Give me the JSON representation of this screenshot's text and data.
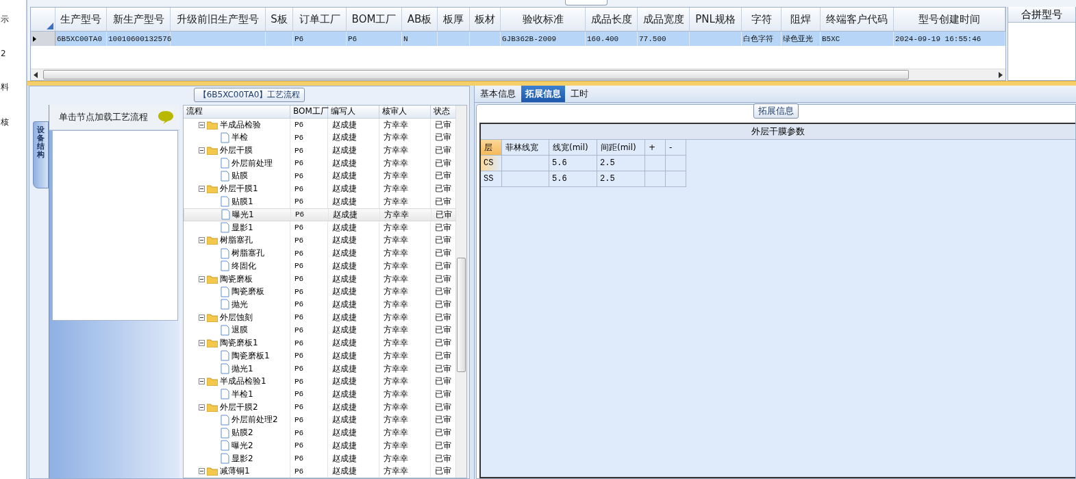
{
  "left_strip": [
    "示",
    "2",
    "料",
    "核"
  ],
  "main_grid": {
    "columns": [
      "生产型号",
      "新生产型号",
      "升级前旧生产型号",
      "S板",
      "订单工厂",
      "BOM工厂",
      "AB板",
      "板厚",
      "板材",
      "验收标准",
      "成品长度",
      "成品宽度",
      "PNL规格",
      "字符",
      "阻焊",
      "终端客户代码",
      "型号创建时间"
    ],
    "rows": [
      {
        "selected": true,
        "cells": [
          "6B5XC00TA0",
          "10010600132576",
          null,
          null,
          "P6",
          "P6",
          "N",
          null,
          null,
          "GJB362B-2009",
          "160.400",
          "77.500",
          null,
          "白色字符",
          "绿色亚光",
          "B5XC",
          "2024-09-19 16:55:46"
        ]
      }
    ]
  },
  "merge_panel": {
    "title": "合拼型号"
  },
  "process_panel": {
    "title": "【6B5XC00TA0】工艺流程",
    "side_tab": "设备结构",
    "hint": "单击节点加载工艺流程",
    "columns": [
      "流程",
      "BOM工厂",
      "编写人",
      "核审人",
      "状态"
    ],
    "tree": [
      {
        "name": "半成品检验",
        "bom": "P6",
        "author": "赵成捷",
        "reviewer": "方幸幸",
        "status": "已审",
        "expanded": true,
        "children": [
          {
            "name": "半检",
            "bom": "P6",
            "author": "赵成捷",
            "reviewer": "方幸幸",
            "status": "已审",
            "selected": false
          }
        ]
      },
      {
        "name": "外层干膜",
        "bom": "P6",
        "author": "赵成捷",
        "reviewer": "方幸幸",
        "status": "已审",
        "expanded": true,
        "children": [
          {
            "name": "外层前处理",
            "bom": "P6",
            "author": "赵成捷",
            "reviewer": "方幸幸",
            "status": "已审",
            "selected": false
          },
          {
            "name": "贴膜",
            "bom": "P6",
            "author": "赵成捷",
            "reviewer": "方幸幸",
            "status": "已审",
            "selected": false
          }
        ]
      },
      {
        "name": "外层干膜1",
        "bom": "P6",
        "author": "赵成捷",
        "reviewer": "方幸幸",
        "status": "已审",
        "expanded": true,
        "children": [
          {
            "name": "贴膜1",
            "bom": "P6",
            "author": "赵成捷",
            "reviewer": "方幸幸",
            "status": "已审",
            "selected": false
          },
          {
            "name": "曝光1",
            "bom": "P6",
            "author": "赵成捷",
            "reviewer": "方幸幸",
            "status": "已审",
            "selected": true
          },
          {
            "name": "显影1",
            "bom": "P6",
            "author": "赵成捷",
            "reviewer": "方幸幸",
            "status": "已审",
            "selected": false
          }
        ]
      },
      {
        "name": "树脂塞孔",
        "bom": "P6",
        "author": "赵成捷",
        "reviewer": "方幸幸",
        "status": "已审",
        "expanded": true,
        "children": [
          {
            "name": "树脂塞孔",
            "bom": "P6",
            "author": "赵成捷",
            "reviewer": "方幸幸",
            "status": "已审",
            "selected": false
          },
          {
            "name": "终固化",
            "bom": "P6",
            "author": "赵成捷",
            "reviewer": "方幸幸",
            "status": "已审",
            "selected": false
          }
        ]
      },
      {
        "name": "陶瓷磨板",
        "bom": "P6",
        "author": "赵成捷",
        "reviewer": "方幸幸",
        "status": "已审",
        "expanded": true,
        "children": [
          {
            "name": "陶瓷磨板",
            "bom": "P6",
            "author": "赵成捷",
            "reviewer": "方幸幸",
            "status": "已审",
            "selected": false
          },
          {
            "name": "抛光",
            "bom": "P6",
            "author": "赵成捷",
            "reviewer": "方幸幸",
            "status": "已审",
            "selected": false
          }
        ]
      },
      {
        "name": "外层蚀刻",
        "bom": "P6",
        "author": "赵成捷",
        "reviewer": "方幸幸",
        "status": "已审",
        "expanded": true,
        "children": [
          {
            "name": "退膜",
            "bom": "P6",
            "author": "赵成捷",
            "reviewer": "方幸幸",
            "status": "已审",
            "selected": false
          }
        ]
      },
      {
        "name": "陶瓷磨板1",
        "bom": "P6",
        "author": "赵成捷",
        "reviewer": "方幸幸",
        "status": "已审",
        "expanded": true,
        "children": [
          {
            "name": "陶瓷磨板1",
            "bom": "P6",
            "author": "赵成捷",
            "reviewer": "方幸幸",
            "status": "已审",
            "selected": false
          },
          {
            "name": "抛光1",
            "bom": "P6",
            "author": "赵成捷",
            "reviewer": "方幸幸",
            "status": "已审",
            "selected": false
          }
        ]
      },
      {
        "name": "半成品检验1",
        "bom": "P6",
        "author": "赵成捷",
        "reviewer": "方幸幸",
        "status": "已审",
        "expanded": true,
        "children": [
          {
            "name": "半检1",
            "bom": "P6",
            "author": "赵成捷",
            "reviewer": "方幸幸",
            "status": "已审",
            "selected": false
          }
        ]
      },
      {
        "name": "外层干膜2",
        "bom": "P6",
        "author": "赵成捷",
        "reviewer": "方幸幸",
        "status": "已审",
        "expanded": true,
        "children": [
          {
            "name": "外层前处理2",
            "bom": "P6",
            "author": "赵成捷",
            "reviewer": "方幸幸",
            "status": "已审",
            "selected": false
          },
          {
            "name": "贴膜2",
            "bom": "P6",
            "author": "赵成捷",
            "reviewer": "方幸幸",
            "status": "已审",
            "selected": false
          },
          {
            "name": "曝光2",
            "bom": "P6",
            "author": "赵成捷",
            "reviewer": "方幸幸",
            "status": "已审",
            "selected": false
          },
          {
            "name": "显影2",
            "bom": "P6",
            "author": "赵成捷",
            "reviewer": "方幸幸",
            "status": "已审",
            "selected": false
          }
        ]
      },
      {
        "name": "减薄铜1",
        "bom": "P6",
        "author": "赵成捷",
        "reviewer": "方幸幸",
        "status": "已审",
        "expanded": true
      }
    ]
  },
  "detail_panel": {
    "tabs": [
      {
        "label": "基本信息",
        "selected": false
      },
      {
        "label": "拓展信息",
        "selected": true
      },
      {
        "label": "工时",
        "selected": false
      }
    ],
    "group_title": "拓展信息",
    "table_title": "外层干膜参数",
    "columns": [
      "层",
      "菲林线宽",
      "线宽(mil)",
      "间距(mil)",
      "+",
      "-"
    ],
    "rows": [
      {
        "selected": true,
        "cells": [
          "CS",
          null,
          "5.6",
          "2.5",
          null,
          null
        ]
      },
      {
        "selected": false,
        "cells": [
          "SS",
          null,
          "5.6",
          "2.5",
          null,
          null
        ]
      }
    ]
  }
}
